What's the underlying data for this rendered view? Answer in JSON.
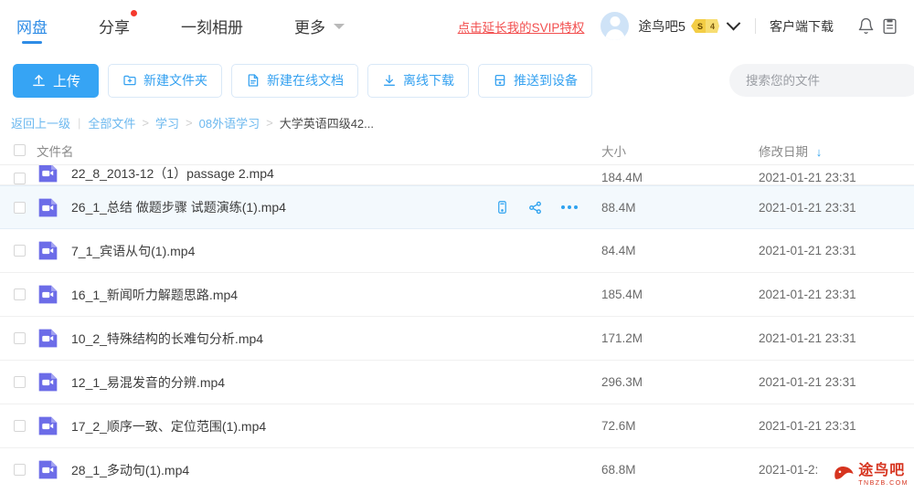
{
  "nav": {
    "tabs": [
      {
        "label": "网盘",
        "active": true,
        "dot": false
      },
      {
        "label": "分享",
        "active": false,
        "dot": true
      },
      {
        "label": "一刻相册",
        "active": false,
        "dot": false
      },
      {
        "label": "更多",
        "active": false,
        "dot": false,
        "caret": true
      }
    ],
    "svip_link": "点击延长我的SVIP特权",
    "username": "途鸟吧5",
    "vip_badge": {
      "tier": "S",
      "level": "4"
    },
    "client_download": "客户端下载",
    "icons": [
      "bell-icon",
      "clipboard-icon"
    ]
  },
  "toolbar": {
    "upload": "上传",
    "new_folder": "新建文件夹",
    "new_doc": "新建在线文档",
    "offline_dl": "离线下载",
    "push_device": "推送到设备"
  },
  "search": {
    "placeholder": "搜索您的文件",
    "value": ""
  },
  "breadcrumb": {
    "back": "返回上一级",
    "items": [
      "全部文件",
      "学习",
      "08外语学习"
    ],
    "current": "大学英语四级42..."
  },
  "table": {
    "headers": {
      "name": "文件名",
      "size": "大小",
      "date": "修改日期"
    },
    "sort": {
      "column": "date",
      "direction": "desc",
      "glyph": "↓"
    },
    "rows": [
      {
        "name": "22_8_2013-12（1）passage 2.mp4",
        "size": "184.4M",
        "date": "2021-01-21 23:31",
        "selected": false,
        "clipped": true
      },
      {
        "name": "26_1_总结 做题步骤 试题演练(1).mp4",
        "size": "88.4M",
        "date": "2021-01-21 23:31",
        "selected": true,
        "clipped": false
      },
      {
        "name": "7_1_宾语从句(1).mp4",
        "size": "84.4M",
        "date": "2021-01-21 23:31",
        "selected": false,
        "clipped": false
      },
      {
        "name": "16_1_新闻听力解题思路.mp4",
        "size": "185.4M",
        "date": "2021-01-21 23:31",
        "selected": false,
        "clipped": false
      },
      {
        "name": "10_2_特殊结构的长难句分析.mp4",
        "size": "171.2M",
        "date": "2021-01-21 23:31",
        "selected": false,
        "clipped": false
      },
      {
        "name": "12_1_易混发音的分辨.mp4",
        "size": "296.3M",
        "date": "2021-01-21 23:31",
        "selected": false,
        "clipped": false
      },
      {
        "name": "17_2_顺序一致、定位范围(1).mp4",
        "size": "72.6M",
        "date": "2021-01-21 23:31",
        "selected": false,
        "clipped": false
      },
      {
        "name": "28_1_多动句(1).mp4",
        "size": "68.8M",
        "date": "2021-01-2:",
        "selected": false,
        "clipped": false
      }
    ],
    "row_actions": [
      "device-icon",
      "share-icon",
      "more-icon"
    ]
  },
  "watermark": {
    "main": "途鸟吧",
    "sub": "TNBZB.COM"
  },
  "colors": {
    "accent": "#36a4f4",
    "nav_active": "#2e8ce6",
    "svip_red": "#f24f4f",
    "file_icon": "#6c6ce8",
    "selected_row": "#f3f9fd",
    "watermark": "#d6341f"
  }
}
